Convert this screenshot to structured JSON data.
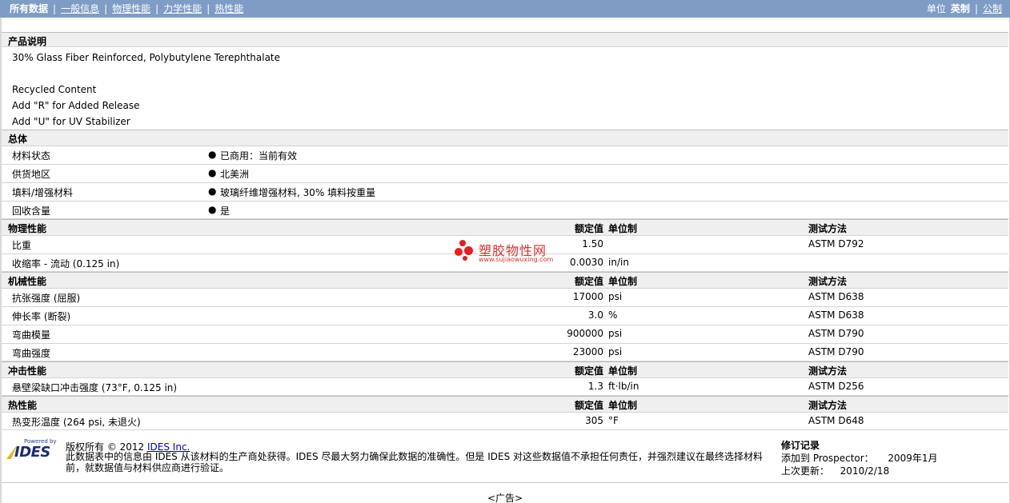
{
  "topbar": {
    "nav": [
      {
        "label": "所有数据",
        "active": true
      },
      {
        "label": "一般信息",
        "active": false
      },
      {
        "label": "物理性能",
        "active": false
      },
      {
        "label": "力学性能",
        "active": false
      },
      {
        "label": "热性能",
        "active": false
      }
    ],
    "units_label": "单位",
    "units_english": "英制",
    "units_metric": "公制",
    "colors": {
      "bar": "#7f9cc5",
      "section": "#efefef"
    }
  },
  "product": {
    "title": "产品说明",
    "lines": [
      "30% Glass Fiber Reinforced, Polybutylene Terephthalate",
      "Recycled Content",
      "Add \"R\" for Added Release",
      "Add \"U\" for UV Stabilizer"
    ]
  },
  "general": {
    "title": "总体",
    "bullet": "●",
    "rows": [
      {
        "label": "材料状态",
        "value": "已商用：当前有效"
      },
      {
        "label": "供货地区",
        "value": "北美洲"
      },
      {
        "label": "填料/增强材料",
        "value": "玻璃纤维增强材料, 30% 填料按重量"
      },
      {
        "label": "回收含量",
        "value": "是"
      }
    ]
  },
  "headers": {
    "value": "额定值",
    "unit": "单位制",
    "method": "测试方法"
  },
  "physical": {
    "title": "物理性能",
    "rows": [
      {
        "label": "比重",
        "value": "1.50",
        "unit": "",
        "method": "ASTM D792"
      },
      {
        "label": "收缩率 - 流动 (0.125 in)",
        "value": "0.0030",
        "unit": "in/in",
        "method": ""
      }
    ]
  },
  "mechanical": {
    "title": "机械性能",
    "rows": [
      {
        "label": "抗张强度 (屈服)",
        "value": "17000",
        "unit": "psi",
        "method": "ASTM D638"
      },
      {
        "label": "伸长率 (断裂)",
        "value": "3.0",
        "unit": "%",
        "method": "ASTM D638"
      },
      {
        "label": "弯曲模量",
        "value": "900000",
        "unit": "psi",
        "method": "ASTM D790"
      },
      {
        "label": "弯曲强度",
        "value": "23000",
        "unit": "psi",
        "method": "ASTM D790"
      }
    ]
  },
  "impact": {
    "title": "冲击性能",
    "rows": [
      {
        "label": "悬壁梁缺口冲击强度 (73°F, 0.125 in)",
        "value": "1.3",
        "unit": "ft·lb/in",
        "method": "ASTM D256"
      }
    ]
  },
  "thermal": {
    "title": "热性能",
    "rows": [
      {
        "label": "热变形温度 (264 psi, 未退火)",
        "value": "305",
        "unit": "°F",
        "method": "ASTM D648"
      }
    ]
  },
  "watermark": {
    "title": "塑胶物性网",
    "url": "www.sujiaowuxing.com"
  },
  "footer": {
    "logo_powered": "Powered by",
    "logo_word": "IDES",
    "copyright": "版权所有 © 2012",
    "company_link": "IDES Inc.",
    "disclaimer": "此数据表中的信息由 IDES 从该材料的生产商处获得。IDES 尽最大努力确保此数据的准确性。但是 IDES 对这些数据值不承担任何责任，并强烈建议在最终选择材料前，就数据值与材料供应商进行验证。",
    "history_title": "修订记录",
    "added_label": "添加到 Prospector：",
    "added_value": "2009年1月",
    "updated_label": "上次更新：",
    "updated_value": "2010/2/18"
  },
  "ad": "<广告>"
}
